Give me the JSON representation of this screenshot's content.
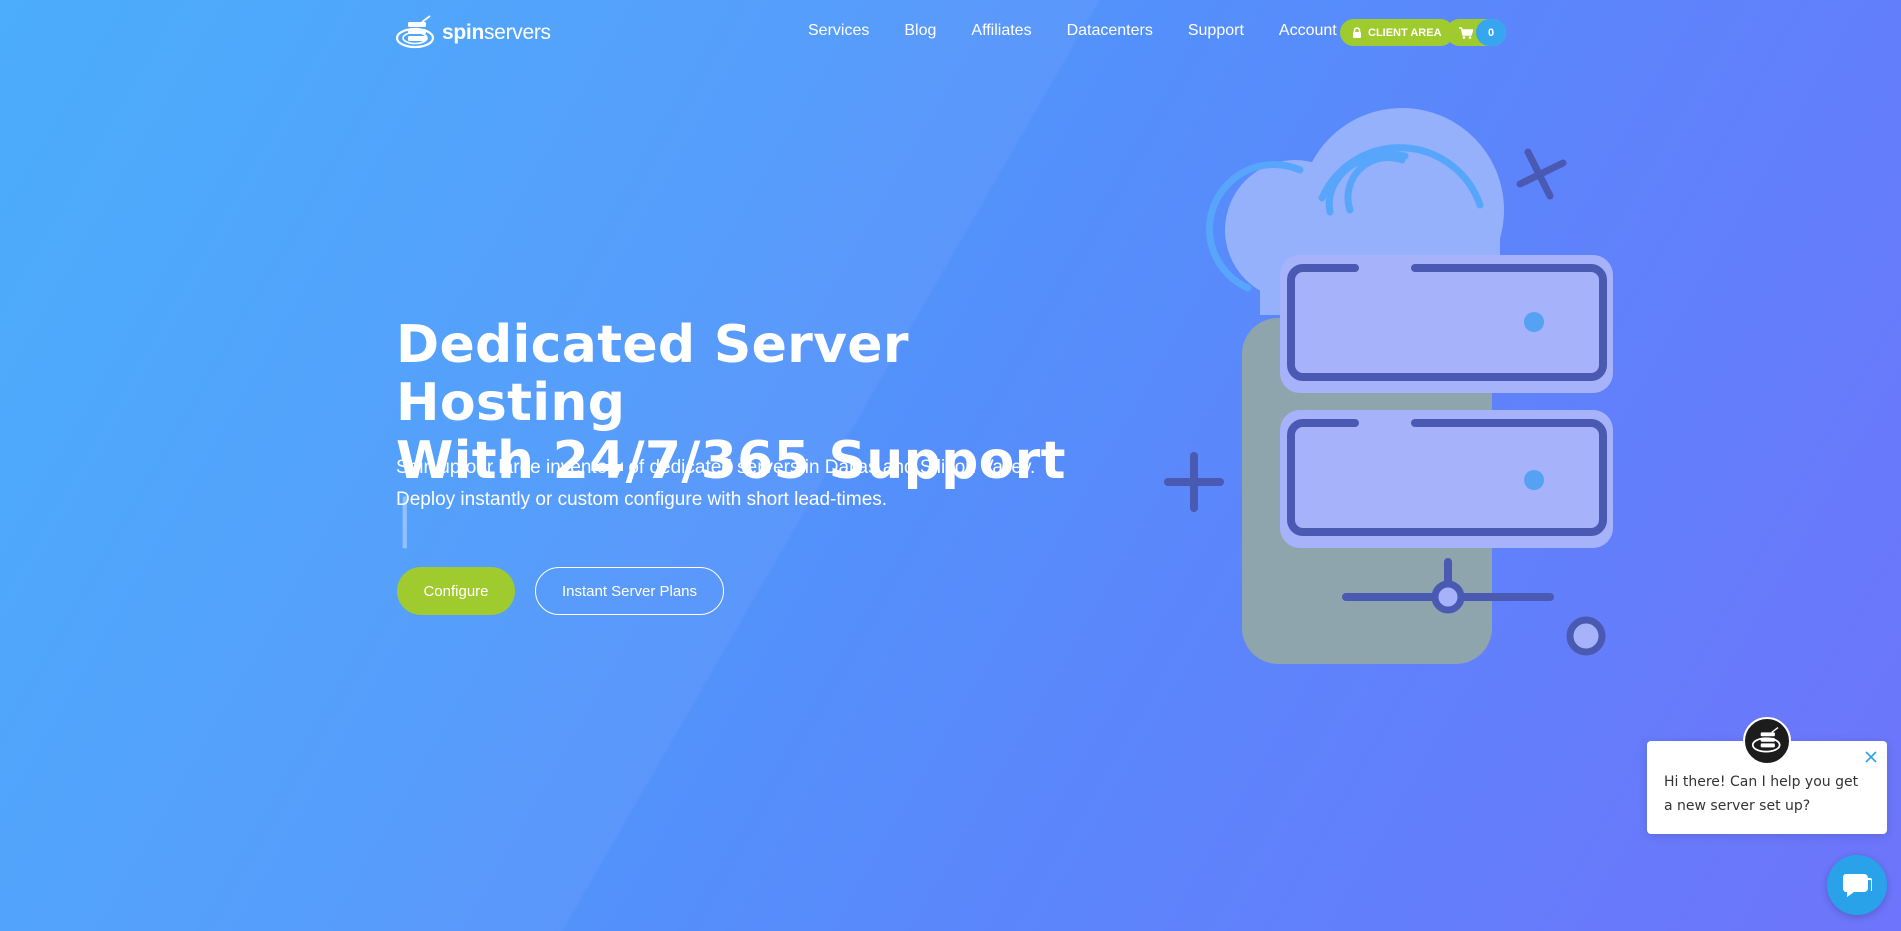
{
  "brand": {
    "name_bold": "spin",
    "name_light": "servers",
    "accent_green": "#a0cb2f",
    "accent_blue": "#37a6f0"
  },
  "nav": {
    "items": [
      {
        "label": "Services"
      },
      {
        "label": "Blog"
      },
      {
        "label": "Affiliates"
      },
      {
        "label": "Datacenters"
      },
      {
        "label": "Support"
      },
      {
        "label": "Account"
      }
    ],
    "client_area_label": "CLIENT AREA",
    "cart_count": "0"
  },
  "hero": {
    "title_line1": "Dedicated Server Hosting",
    "title_line2": "With 24/7/365 Support",
    "cursor": "|",
    "subtitle_line1": "Spin up our large inventory of dedicated servers in Dallas and Silicon Valley.",
    "subtitle_line2": "Deploy instantly or custom configure with short lead-times.",
    "configure_label": "Configure",
    "plans_label": "Instant Server Plans"
  },
  "chat": {
    "message": "Hi there! Can I help you get a new server set up?"
  },
  "icons": [
    "lock-icon",
    "cart-icon",
    "close-icon",
    "chat-bubble-icon",
    "server-cloud-illustration"
  ]
}
